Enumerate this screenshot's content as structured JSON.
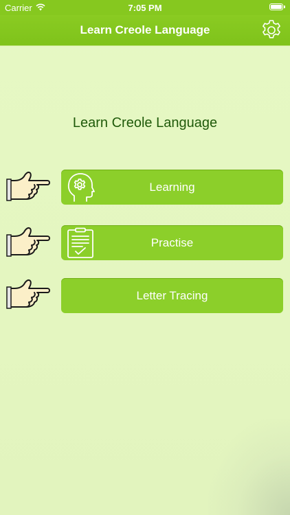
{
  "status_bar": {
    "carrier": "Carrier",
    "time": "7:05 PM"
  },
  "navbar": {
    "title": "Learn Creole Language",
    "settings_icon": "gear-icon"
  },
  "page": {
    "heading": "Learn Creole Language"
  },
  "menu": [
    {
      "label": "Learning",
      "icon": "head-gear-icon"
    },
    {
      "label": "Practise",
      "icon": "clipboard-check-icon"
    },
    {
      "label": "Letter Tracing",
      "icon": ""
    }
  ],
  "colors": {
    "primary": "#86c81f",
    "button": "#8ccf2a",
    "heading": "#1f5a0a",
    "background": "#e4f6c0"
  }
}
